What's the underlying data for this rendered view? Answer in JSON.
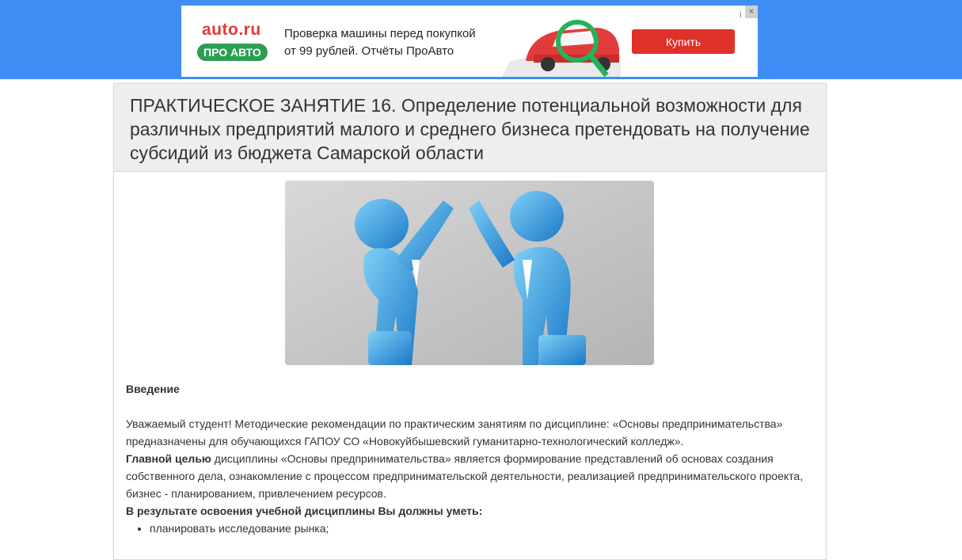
{
  "ad": {
    "brand": "auto.ru",
    "badge": "ПРО АВТО",
    "line1": "Проверка машины перед покупкой",
    "line2": "от 99 рублей. Отчёты ПроАвто",
    "button": "Купить",
    "close": "×",
    "info": "i",
    "accent": "#e53935",
    "badge_color": "#2e9e54"
  },
  "page": {
    "title": "ПРАКТИЧЕСКОЕ ЗАНЯТИЕ 16. Определение потенциальной возможности для различных предприятий малого и среднего бизнеса претендовать на получение субсидий из бюджета Самарской области",
    "image_icon": "two-businessmen-high-five-image",
    "intro_heading": "Введение",
    "p1": "Уважаемый студент! Методические рекомендации по практическим занятиям по дисциплине: «Основы предпринимательства» предназначены для обучающихся ГАПОУ СО «Новокуйбышевский гуманитарно-технологический колледж».",
    "goal_bold": "Главной  целью",
    "goal_rest": "  дисциплины  «Основы предпринимательства» является формирование представлений об основах создания собственного дела, ознакомление с процессом предпринимательской деятельности, реализацией предпринимательского проекта, бизнес - планированием, привлечением ресурсов.",
    "skills_heading": "В результате освоения учебной дисциплины Вы должны уметь:",
    "skills": [
      "планировать исследование рынка;"
    ]
  },
  "colors": {
    "header_band": "#3f8ef5",
    "card_head": "#eeeeee"
  }
}
